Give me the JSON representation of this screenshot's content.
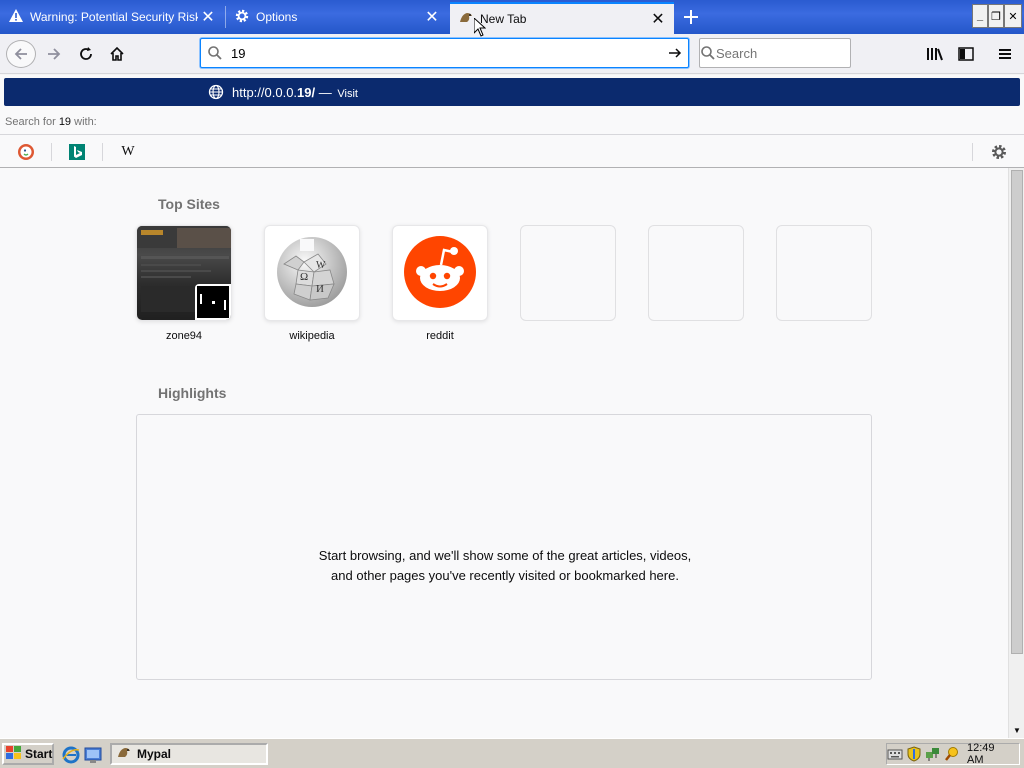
{
  "tabs": [
    {
      "title": "Warning: Potential Security Risk Ahead",
      "icon": "warning-icon"
    },
    {
      "title": "Options",
      "icon": "gear-icon"
    },
    {
      "title": "New Tab",
      "icon": "mypal-icon"
    }
  ],
  "urlbar": {
    "value": "19"
  },
  "searchbar": {
    "placeholder": "Search"
  },
  "suggestion": {
    "url_prefix": "http://0.0.0.",
    "url_bold": "19/",
    "separator": "—",
    "action": "Visit"
  },
  "search_for": {
    "prefix": "Search for ",
    "term": "19",
    "suffix": " with:"
  },
  "engines": [
    {
      "name": "DuckDuckGo",
      "icon": "duckduckgo-icon"
    },
    {
      "name": "Bing",
      "icon": "bing-icon"
    },
    {
      "name": "Wikipedia",
      "icon": "wikipedia-icon",
      "glyph": "W"
    }
  ],
  "topsites": {
    "title": "Top Sites",
    "items": [
      {
        "label": "zone94",
        "color": "#2d2d2d"
      },
      {
        "label": "wikipedia",
        "color": "#ffffff"
      },
      {
        "label": "reddit",
        "color": "#ff4500"
      },
      {
        "label": ""
      },
      {
        "label": ""
      },
      {
        "label": ""
      }
    ]
  },
  "highlights": {
    "title": "Highlights",
    "message": "Start browsing, and we'll show some of the great articles, videos, and other pages you've recently visited or bookmarked here."
  },
  "taskbar": {
    "start_label": "Start",
    "task_label": "Mypal",
    "clock": "12:49 AM"
  },
  "colors": {
    "titlebar": "#2a5bd0",
    "suggestion_highlight": "#0b2a6e",
    "accent": "#0a84ff",
    "reddit": "#ff4500"
  }
}
